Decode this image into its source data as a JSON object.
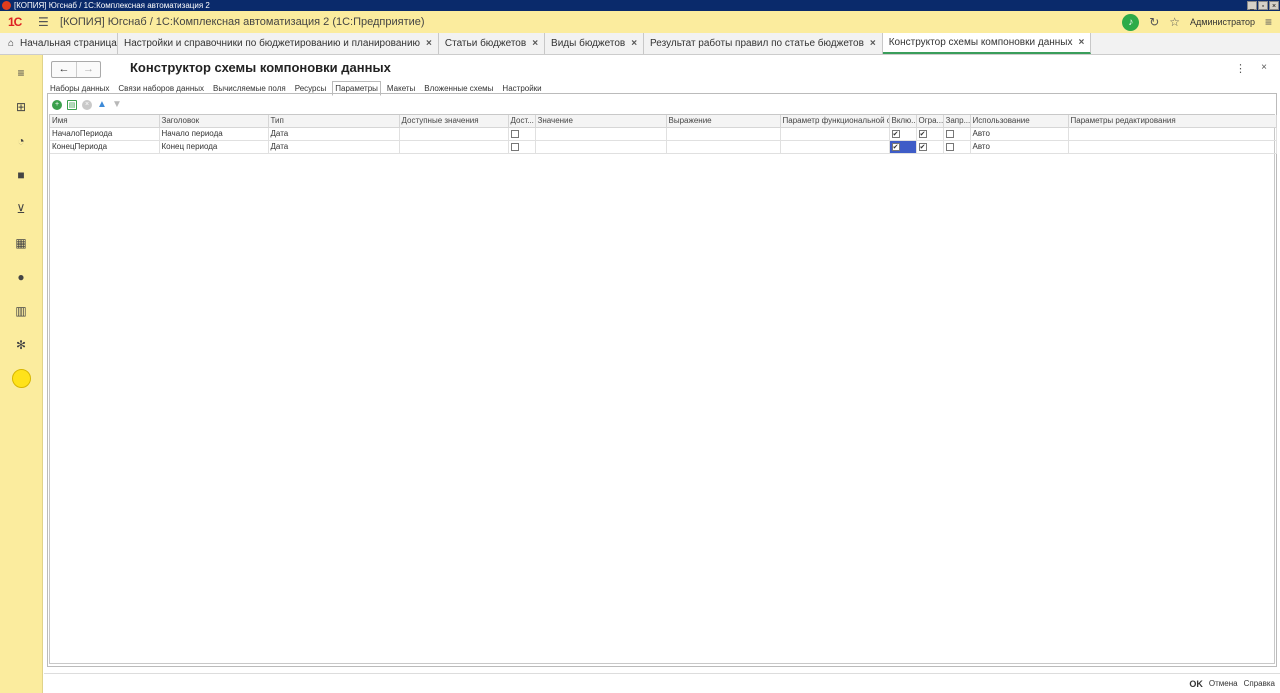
{
  "os_title": "[КОПИЯ] Югснаб / 1С:Комплексная автоматизация 2",
  "app": {
    "logo": "1С",
    "title": "[КОПИЯ] Югснаб / 1С:Комплексная автоматизация 2  (1С:Предприятие)",
    "user": "Администратор"
  },
  "tabs": [
    {
      "label": "Начальная страница"
    },
    {
      "label": "Настройки и справочники по бюджетированию и планированию"
    },
    {
      "label": "Статьи бюджетов"
    },
    {
      "label": "Виды  бюджетов"
    },
    {
      "label": "Результат работы правил по статье бюджетов"
    },
    {
      "label": "Конструктор схемы компоновки данных"
    }
  ],
  "sidebar": [
    "menu-icon",
    "org-chart-icon",
    "pie-chart-icon",
    "bag-icon",
    "cart-icon",
    "warehouse-icon",
    "ruble-icon",
    "bar-chart-icon",
    "gear-icon",
    "circle-icon"
  ],
  "form": {
    "title": "Конструктор схемы компоновки данных",
    "sub_tabs": [
      "Наборы данных",
      "Связи наборов данных",
      "Вычисляемые поля",
      "Ресурсы",
      "Параметры",
      "Макеты",
      "Вложенные схемы",
      "Настройки"
    ],
    "active_sub_tab": "Параметры"
  },
  "grid": {
    "columns": [
      "Имя",
      "Заголовок",
      "Тип",
      "Доступные значения",
      "Дост...",
      "Значение",
      "Выражение",
      "Параметр функциональной о...",
      "Вклю...",
      "Огра...",
      "Запр...",
      "Использование",
      "Параметры редактирования"
    ],
    "rows": [
      {
        "name": "НачалоПериода",
        "title": "Начало периода",
        "type": "Дата",
        "usage": "Авто",
        "dost": false,
        "vkl": true,
        "ogr": true,
        "zapr": false
      },
      {
        "name": "КонецПериода",
        "title": "Конец периода",
        "type": "Дата",
        "usage": "Авто",
        "dost": false,
        "vkl": true,
        "ogr": true,
        "zapr": false
      }
    ]
  },
  "footer": {
    "ok": "OK",
    "cancel": "Отмена",
    "help": "Справка"
  },
  "colors": {
    "accent_yellow": "#fbec9e",
    "active_tab_underline": "#3a9e5b",
    "selection": "#3e5cc7"
  }
}
